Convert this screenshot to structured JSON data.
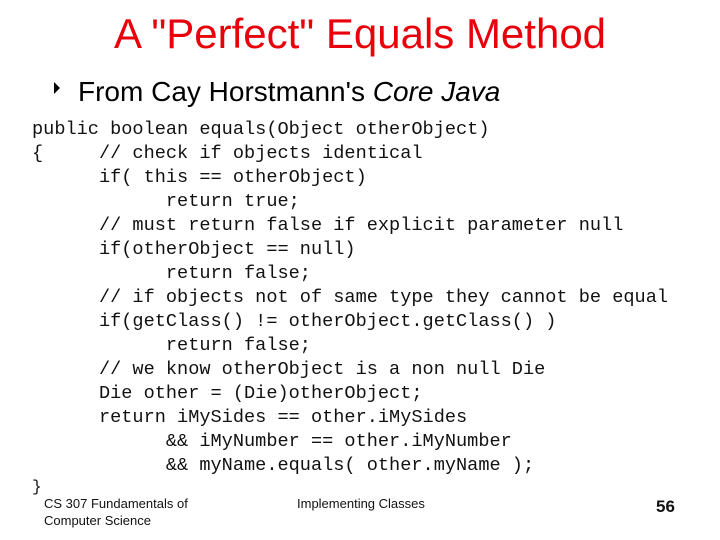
{
  "slide": {
    "title": "A \"Perfect\" Equals Method",
    "bullet": {
      "icon": "triangle-bullet-icon",
      "text_plain": "From Cay Horstmann's ",
      "text_italic": "Core Java"
    },
    "code_lines": [
      "public boolean equals(Object otherObject)",
      "{     // check if objects identical",
      "      if( this == otherObject)",
      "            return true;",
      "      // must return false if explicit parameter null",
      "      if(otherObject == null)",
      "            return false;",
      "      // if objects not of same type they cannot be equal",
      "      if(getClass() != otherObject.getClass() )",
      "            return false;",
      "      // we know otherObject is a non null Die",
      "      Die other = (Die)otherObject;",
      "      return iMySides == other.iMySides",
      "            && iMyNumber == other.iMyNumber",
      "            && myName.equals( other.myName );"
    ],
    "closing_brace": "}",
    "footer": {
      "course": "CS 307 Fundamentals of Computer Science",
      "topic": "Implementing Classes",
      "page_number": "56"
    },
    "colors": {
      "title": "#e8000b",
      "text": "#000000",
      "background": "#ffffff"
    }
  }
}
